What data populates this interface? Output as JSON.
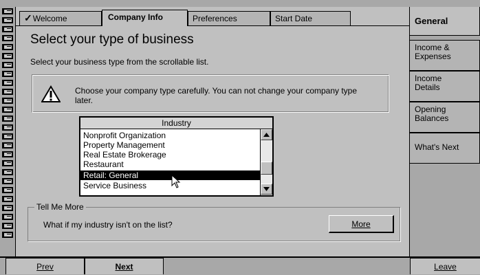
{
  "tabs": [
    {
      "label": "Welcome",
      "checked": true
    },
    {
      "label": "Company Info",
      "active": true
    },
    {
      "label": "Preferences"
    },
    {
      "label": "Start Date"
    }
  ],
  "page": {
    "title": "Select your type of business",
    "subtitle": "Select your business type from the scrollable list."
  },
  "warning": {
    "icon": "warning-triangle-icon",
    "text": "Choose your company type carefully. You can not change your company type later."
  },
  "industry_list": {
    "header": "Industry",
    "items": [
      "Nonprofit Organization",
      "Property Management",
      "Real Estate Brokerage",
      "Restaurant",
      "Retail: General",
      "Service Business"
    ],
    "selected": "Retail: General"
  },
  "tell_me_more": {
    "legend": "Tell Me More",
    "question": "What if my industry isn't on the list?",
    "button": "More"
  },
  "nav": {
    "items": [
      {
        "label": "General",
        "active": true
      },
      {
        "label": "Income & Expenses"
      },
      {
        "label": "Income Details"
      },
      {
        "label": "Opening Balances"
      },
      {
        "label": "What's Next"
      }
    ]
  },
  "footer": {
    "prev": "Prev",
    "next": "Next",
    "leave": "Leave"
  }
}
